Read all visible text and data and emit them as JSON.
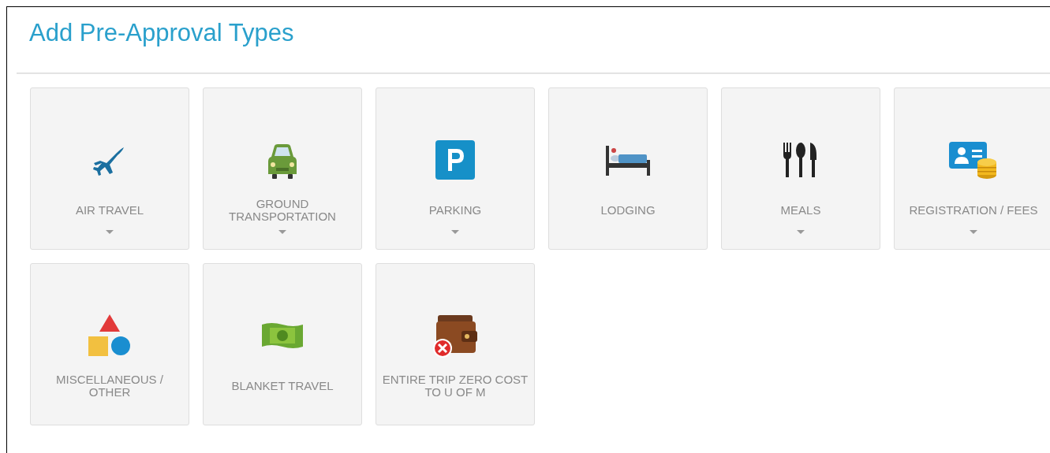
{
  "title": "Add Pre-Approval Types",
  "tiles": [
    {
      "label": "AIR TRAVEL",
      "expandable": true
    },
    {
      "label": "GROUND TRANSPORTATION",
      "expandable": true
    },
    {
      "label": "PARKING",
      "expandable": true
    },
    {
      "label": "LODGING",
      "expandable": false
    },
    {
      "label": "MEALS",
      "expandable": true
    },
    {
      "label": "REGISTRATION / FEES",
      "expandable": true
    },
    {
      "label": "MISCELLANEOUS / OTHER",
      "expandable": false
    },
    {
      "label": "BLANKET TRAVEL",
      "expandable": false
    },
    {
      "label": "ENTIRE TRIP ZERO COST TO U OF M",
      "expandable": false
    }
  ]
}
